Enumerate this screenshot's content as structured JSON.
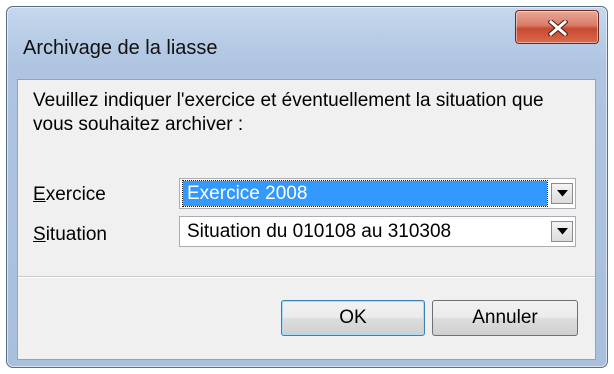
{
  "window": {
    "title": "Archivage de la liasse",
    "close_icon": "close-icon"
  },
  "dialog": {
    "instructions": "Veuillez indiquer l'exercice et éventuellement la situation que vous souhaitez archiver :",
    "fields": {
      "exercice": {
        "label": "Exercice",
        "accesskey": "E",
        "value": "Exercice 2008",
        "selected": true
      },
      "situation": {
        "label": "Situation",
        "accesskey": "S",
        "value": "Situation du 010108 au 310308",
        "selected": false
      }
    },
    "buttons": {
      "ok": "OK",
      "cancel": "Annuler"
    }
  },
  "colors": {
    "selection": "#3399ff",
    "close_button": "#c84a2f",
    "frame": "#b9cde6",
    "client_background": "#f0f0f0"
  }
}
